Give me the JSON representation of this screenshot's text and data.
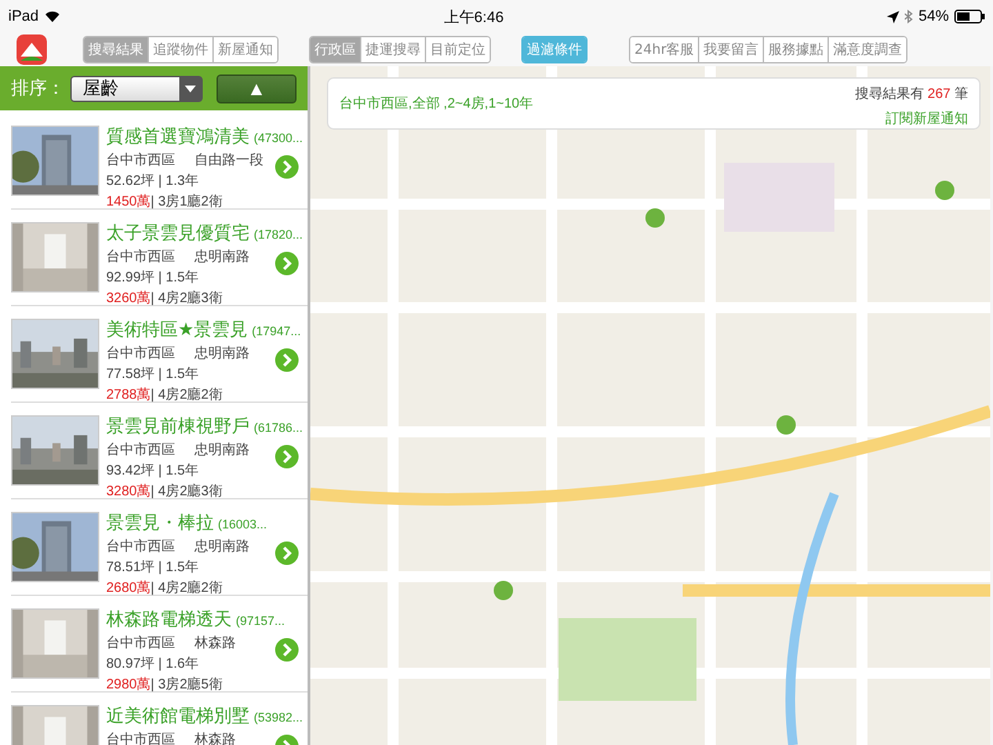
{
  "status_bar": {
    "device": "iPad",
    "time": "上午6:46",
    "battery": "54%"
  },
  "toolbar": {
    "groups": [
      {
        "buttons": [
          {
            "label": "搜尋結果",
            "selected": true
          },
          {
            "label": "追蹤物件",
            "selected": false
          },
          {
            "label": "新屋通知",
            "selected": false
          }
        ]
      },
      {
        "buttons": [
          {
            "label": "行政區",
            "selected": true
          },
          {
            "label": "捷運搜尋",
            "selected": false
          },
          {
            "label": "目前定位",
            "selected": false
          }
        ]
      },
      {
        "buttons": [
          {
            "label": "過濾條件",
            "selected": true
          }
        ]
      },
      {
        "buttons": [
          {
            "label": "24hr客服",
            "selected": false
          },
          {
            "label": "我要留言",
            "selected": false
          },
          {
            "label": "服務據點",
            "selected": false
          },
          {
            "label": "滿意度調查",
            "selected": false
          }
        ]
      }
    ]
  },
  "sort": {
    "label": "排序：",
    "value": "屋齡",
    "order_button": "▲"
  },
  "listings": [
    {
      "title": "質感首選寶鴻清美",
      "code": "(47300...",
      "district": "台中市西區",
      "road": "自由路一段",
      "size_age": "52.62坪 | 1.3年",
      "price": "1450萬",
      "layout": " | 3房1廳2衛"
    },
    {
      "title": "太子景雲見優質宅",
      "code": "(17820...",
      "district": "台中市西區",
      "road": "忠明南路",
      "size_age": "92.99坪 | 1.5年",
      "price": "3260萬",
      "layout": " | 4房2廳3衛"
    },
    {
      "title": "美術特區★景雲見",
      "code": "(17947...",
      "district": "台中市西區",
      "road": "忠明南路",
      "size_age": "77.58坪 | 1.5年",
      "price": "2788萬",
      "layout": " | 4房2廳2衛"
    },
    {
      "title": "景雲見前棟視野戶",
      "code": "(61786...",
      "district": "台中市西區",
      "road": "忠明南路",
      "size_age": "93.42坪 | 1.5年",
      "price": "3280萬",
      "layout": " | 4房2廳3衛"
    },
    {
      "title": "景雲見・棒拉",
      "code": "(16003...",
      "district": "台中市西區",
      "road": "忠明南路",
      "size_age": "78.51坪 | 1.5年",
      "price": "2680萬",
      "layout": " | 4房2廳2衛"
    },
    {
      "title": "林森路電梯透天",
      "code": "(97157...",
      "district": "台中市西區",
      "road": "林森路",
      "size_age": "80.97坪 | 1.6年",
      "price": "2980萬",
      "layout": " | 3房2廳5衛"
    },
    {
      "title": "近美術館電梯別墅",
      "code": "(53982...",
      "district": "台中市西區",
      "road": "林森路"
    }
  ],
  "result_card": {
    "criteria": "台中市西區,全部 ,2~4房,1~10年",
    "count_prefix": "搜尋結果有",
    "count": "267",
    "count_suffix": "筆",
    "subscribe_link": "訂閱新屋通知"
  }
}
